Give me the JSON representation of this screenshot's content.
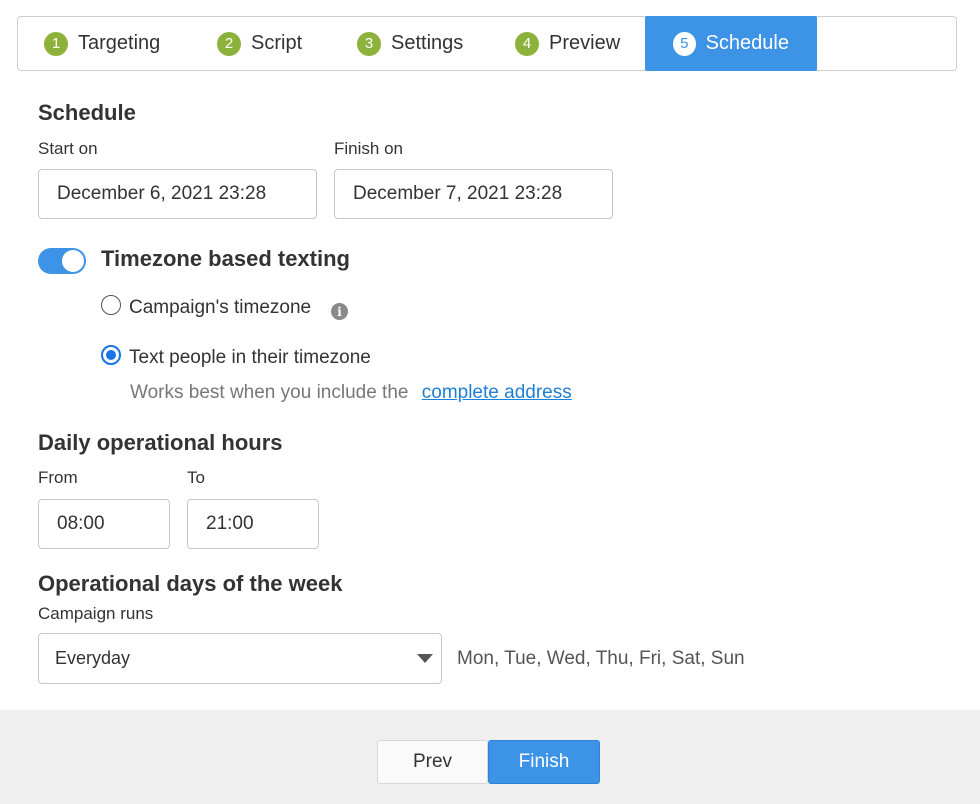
{
  "stepper": {
    "steps": [
      {
        "num": "1",
        "label": "Targeting"
      },
      {
        "num": "2",
        "label": "Script"
      },
      {
        "num": "3",
        "label": "Settings"
      },
      {
        "num": "4",
        "label": "Preview"
      },
      {
        "num": "5",
        "label": "Schedule"
      }
    ],
    "active_index": 4,
    "colors": {
      "complete": "#8cb23c",
      "active": "#3d93e5"
    }
  },
  "schedule": {
    "title": "Schedule",
    "start_label": "Start on",
    "start_value": "December 6, 2021 23:28",
    "finish_label": "Finish on",
    "finish_value": "December 7, 2021 23:28"
  },
  "timezone": {
    "toggle_label": "Timezone based texting",
    "toggle_on": true,
    "option_campaign": "Campaign's timezone",
    "option_people": "Text people in their timezone",
    "selected": "people",
    "hint_text": "Works best when you include the",
    "hint_link": "complete address"
  },
  "hours": {
    "title": "Daily operational hours",
    "from_label": "From",
    "from_value": "08:00",
    "to_label": "To",
    "to_value": "21:00"
  },
  "days": {
    "title": "Operational days of the week",
    "runs_label": "Campaign runs",
    "select_value": "Everyday",
    "summary": "Mon, Tue, Wed, Thu, Fri, Sat, Sun"
  },
  "footer": {
    "prev_label": "Prev",
    "finish_label": "Finish"
  }
}
